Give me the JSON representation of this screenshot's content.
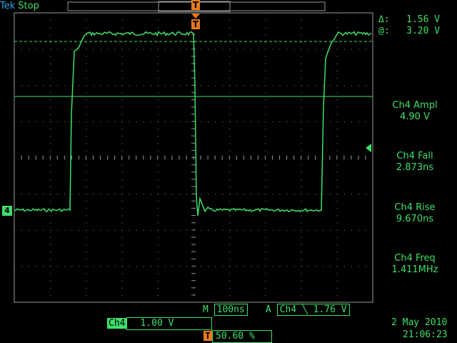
{
  "header": {
    "brand": "Tek",
    "status": "Stop"
  },
  "cursor_readout": {
    "delta_label": "Δ:",
    "delta_value": "1.56 V",
    "at_label": "@:",
    "at_value": "3.20 V"
  },
  "measurements": [
    {
      "label": "Ch4 Ampl",
      "value": "4.90 V"
    },
    {
      "label": "Ch4 Fall",
      "value": "2.873ns"
    },
    {
      "label": "Ch4 Rise",
      "value": "9.670ns"
    },
    {
      "label": "Ch4 Freq",
      "value": "1.411MHz"
    }
  ],
  "bottom": {
    "ch_label": "Ch4",
    "ch_scale": "1.00 V",
    "timebase_prefix": "M",
    "timebase": "100ns",
    "trigger_prefix": "A",
    "trigger_channel": "Ch4",
    "trigger_slope_icon": "falling-edge-icon",
    "trigger_level": "1.76 V",
    "trigger_pos_badge": "T",
    "trigger_pos": "50.60 %",
    "date": "2 May 2010",
    "time": "21:06:23"
  },
  "channel_marker": "4",
  "trigger_marker": "T",
  "colors": {
    "trace": "#3de06a",
    "brand": "#2aa8e8",
    "trigger": "#e87a1a",
    "grid": "#9a9a9a"
  }
}
